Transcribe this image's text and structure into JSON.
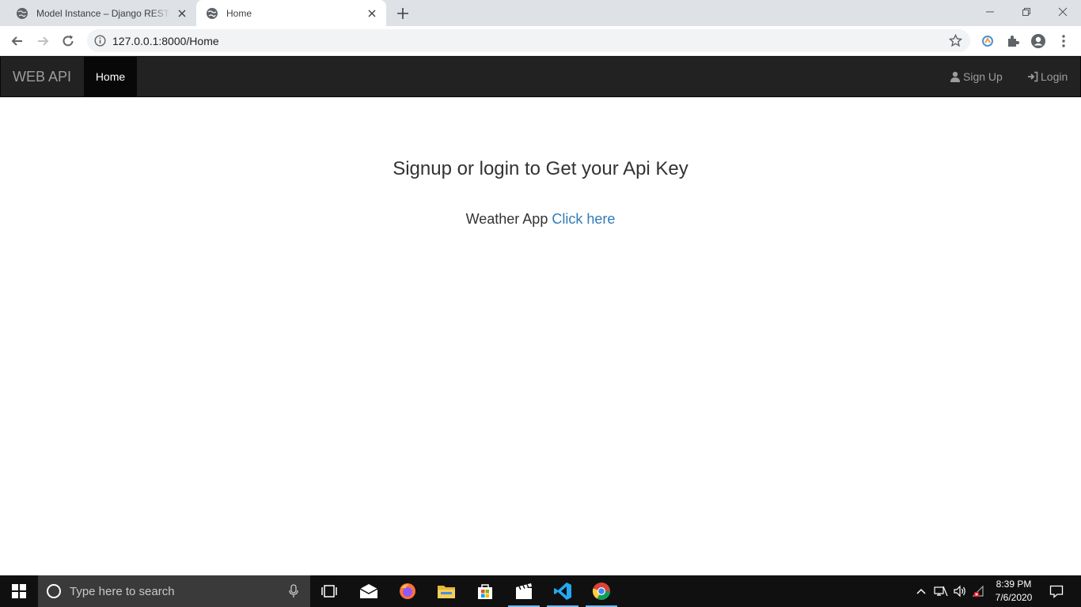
{
  "browser": {
    "tabs": [
      {
        "title": "Model Instance – Django REST fr",
        "favicon": "globe-icon",
        "active": false
      },
      {
        "title": "Home",
        "favicon": "globe-icon",
        "active": true
      }
    ],
    "url": "127.0.0.1:8000/Home"
  },
  "navbar": {
    "brand": "WEB API",
    "home": "Home",
    "signup": "Sign Up",
    "login": "Login"
  },
  "content": {
    "heading": "Signup or login to Get your Api Key",
    "weather_text": "Weather App",
    "weather_link": "Click here"
  },
  "taskbar": {
    "search_placeholder": "Type here to search",
    "time": "8:39 PM",
    "date": "7/6/2020"
  },
  "colors": {
    "navbar_bg": "#222222",
    "link": "#337ab7",
    "taskbar_bg": "#101010"
  }
}
